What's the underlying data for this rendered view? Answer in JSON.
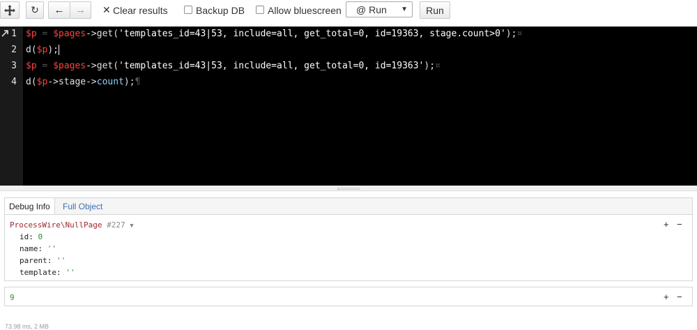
{
  "toolbar": {
    "clear_label": "Clear results",
    "backup_label": "Backup DB",
    "bluescreen_label": "Allow bluescreen",
    "select_value": "@ Run",
    "run_label": "Run"
  },
  "editor": {
    "line_numbers": [
      "1",
      "2",
      "3",
      "4"
    ],
    "line1": {
      "var": "$p",
      "eq": " = ",
      "pages": "$pages",
      "call": "->get(",
      "str": "'templates_id=43|53, include=all, get_total=0, id=19363, stage.count>0'",
      "end": ");"
    },
    "line2": {
      "fn": "d(",
      "var": "$p",
      "end": ");"
    },
    "line3": {
      "var": "$p",
      "eq": " = ",
      "pages": "$pages",
      "call": "->get(",
      "str": "'templates_id=43|53, include=all, get_total=0, id=19363'",
      "end": ");"
    },
    "line4": {
      "fn": "d(",
      "var": "$p",
      "arrow1": "->stage->",
      "count": "count",
      "end": ");"
    }
  },
  "results": {
    "tabs": [
      "Debug Info",
      "Full Object"
    ],
    "panel1": {
      "class_name": "ProcessWire\\NullPage",
      "object_id": "#227",
      "props": [
        {
          "key": "id:",
          "value": "0"
        },
        {
          "key": "name:",
          "value": "''"
        },
        {
          "key": "parent:",
          "value": "''"
        },
        {
          "key": "template:",
          "value": "''"
        }
      ]
    },
    "panel2": {
      "value": "9"
    },
    "plus": "+",
    "minus": "−"
  },
  "footer": "73.98 ms, 2 MB"
}
